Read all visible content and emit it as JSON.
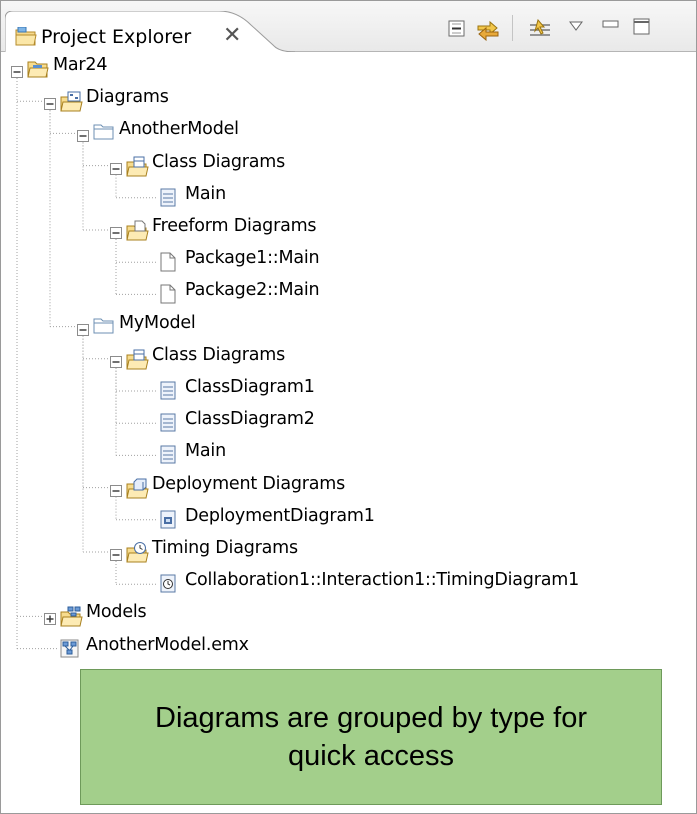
{
  "view": {
    "title": "Project Explorer",
    "close_glyph": "✕",
    "toolbar_icons": [
      "collapse-all-icon",
      "link-with-editor-icon",
      "filter-icon",
      "view-menu-icon",
      "minimize-icon",
      "maximize-icon"
    ]
  },
  "tree": [
    {
      "label": "Mar24",
      "icon": "project-folder-icon",
      "level": 0,
      "toggle": "minus"
    },
    {
      "label": "Diagrams",
      "icon": "diagrams-folder-icon",
      "level": 1,
      "toggle": "minus"
    },
    {
      "label": "AnotherModel",
      "icon": "folder-icon",
      "level": 2,
      "toggle": "minus"
    },
    {
      "label": "Class Diagrams",
      "icon": "class-diagrams-folder-icon",
      "level": 3,
      "toggle": "minus"
    },
    {
      "label": "Main",
      "icon": "class-diagram-icon",
      "level": 4,
      "toggle": "none"
    },
    {
      "label": "Freeform Diagrams",
      "icon": "freeform-diagrams-folder-icon",
      "level": 3,
      "toggle": "minus"
    },
    {
      "label": "Package1::Main",
      "icon": "freeform-diagram-icon",
      "level": 4,
      "toggle": "none"
    },
    {
      "label": "Package2::Main",
      "icon": "freeform-diagram-icon",
      "level": 4,
      "toggle": "none"
    },
    {
      "label": "MyModel",
      "icon": "folder-icon",
      "level": 2,
      "toggle": "minus"
    },
    {
      "label": "Class Diagrams",
      "icon": "class-diagrams-folder-icon",
      "level": 3,
      "toggle": "minus"
    },
    {
      "label": "ClassDiagram1",
      "icon": "class-diagram-icon",
      "level": 4,
      "toggle": "none"
    },
    {
      "label": "ClassDiagram2",
      "icon": "class-diagram-icon",
      "level": 4,
      "toggle": "none"
    },
    {
      "label": "Main",
      "icon": "class-diagram-icon",
      "level": 4,
      "toggle": "none"
    },
    {
      "label": "Deployment Diagrams",
      "icon": "deployment-diagrams-folder-icon",
      "level": 3,
      "toggle": "minus"
    },
    {
      "label": "DeploymentDiagram1",
      "icon": "deployment-diagram-icon",
      "level": 4,
      "toggle": "none"
    },
    {
      "label": "Timing Diagrams",
      "icon": "timing-diagrams-folder-icon",
      "level": 3,
      "toggle": "minus"
    },
    {
      "label": "Collaboration1::Interaction1::TimingDiagram1",
      "icon": "timing-diagram-icon",
      "level": 4,
      "toggle": "none"
    },
    {
      "label": "Models",
      "icon": "models-folder-icon",
      "level": 1,
      "toggle": "plus"
    },
    {
      "label": "AnotherModel.emx",
      "icon": "model-file-icon",
      "level": 1,
      "toggle": "none"
    }
  ],
  "callout": {
    "line1": "Diagrams are grouped by type for",
    "line2": "quick access"
  }
}
